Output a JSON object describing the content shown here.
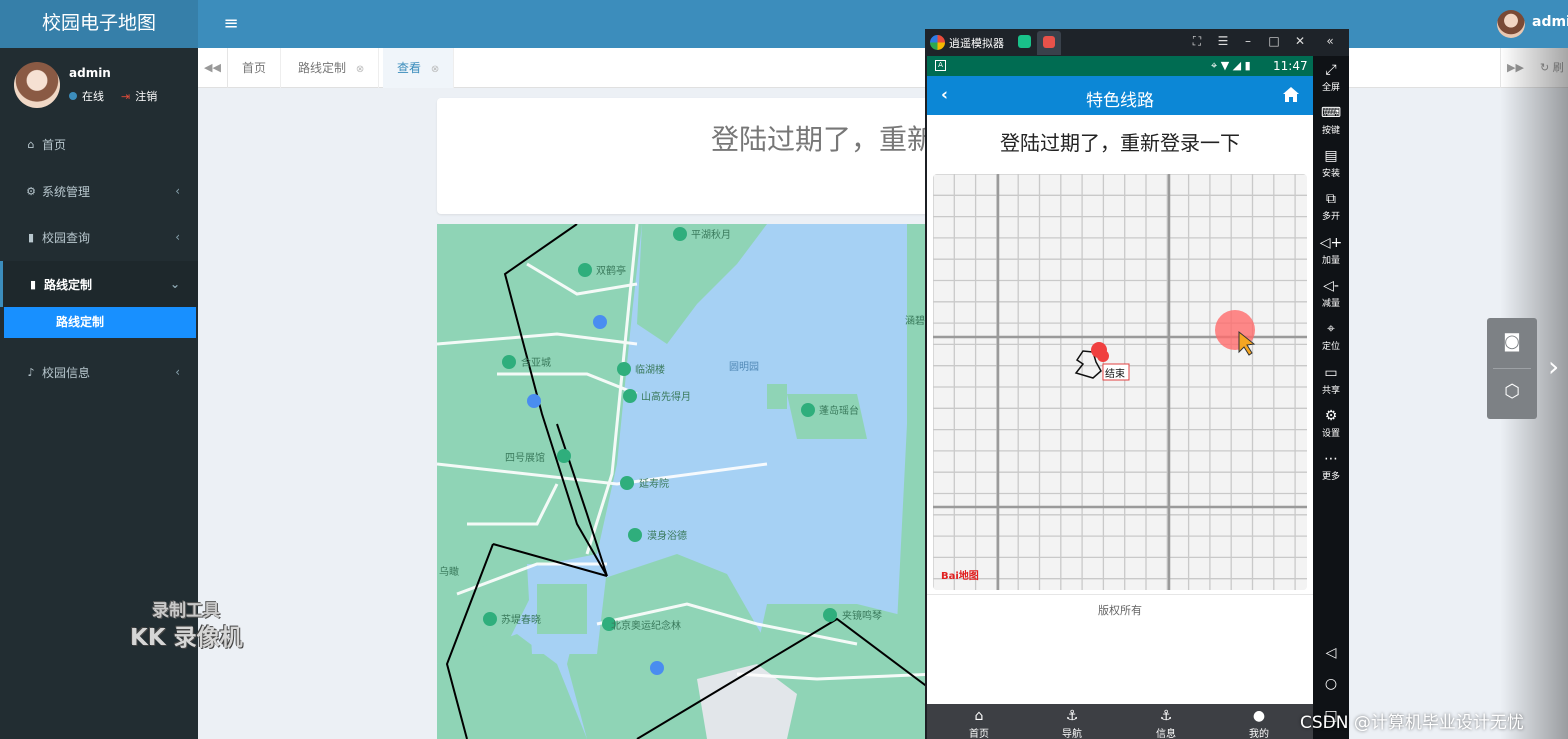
{
  "header": {
    "app_title": "校园电子地图",
    "menu_icon": "hamburger-icon",
    "top_user": "admin"
  },
  "sidebar": {
    "user": {
      "name": "admin",
      "status": "在线",
      "logout": "注销"
    },
    "items": [
      {
        "label": "首页",
        "icon": "home-icon"
      },
      {
        "label": "系统管理",
        "icon": "gear-icon"
      },
      {
        "label": "校园查询",
        "icon": "book-icon"
      },
      {
        "label": "路线定制",
        "icon": "book-icon"
      },
      {
        "label": "校园信息",
        "icon": "bell-icon"
      }
    ],
    "sub_item": "路线定制"
  },
  "tabs": [
    {
      "label": "首页"
    },
    {
      "label": "路线定制"
    },
    {
      "label": "查看"
    }
  ],
  "tab_refresh": "刷",
  "main": {
    "title": "登陆过期了，重新",
    "map_labels": [
      "平湖秋月",
      "双鹤亭",
      "含亚城",
      "临湖楼",
      "山高先得月",
      "圆明园",
      "蓬岛瑶台",
      "四号展馆",
      "延寿院",
      "漠身浴德",
      "乌瞰",
      "苏堤春晓",
      "北京奥运纪念林",
      "夹镜鸣琴",
      "涵碧"
    ]
  },
  "emulator": {
    "name": "逍遥模拟器",
    "side_buttons": [
      "全屏",
      "按键",
      "安装",
      "多开",
      "加量",
      "减量",
      "定位",
      "共享",
      "设置",
      "更多"
    ],
    "phone": {
      "time": "11:47",
      "title": "特色线路",
      "message": "登陆过期了，重新登录一下",
      "marker_label": "结束",
      "baidu_logo": "Bai地图",
      "copyright": "版权所有",
      "bottom_nav": [
        "首页",
        "导航",
        "信息",
        "我的"
      ]
    }
  },
  "watermarks": {
    "kk_line1": "录制工具",
    "kk_line2": "KK 录像机",
    "csdn": "CSDN @计算机毕业设计无忧"
  },
  "colors": {
    "header": "#3c8dbc",
    "sidebar": "#222d32",
    "active_sub": "#1890ff",
    "phone_appbar": "#0c87d6",
    "phone_statusbar": "#006c52"
  }
}
